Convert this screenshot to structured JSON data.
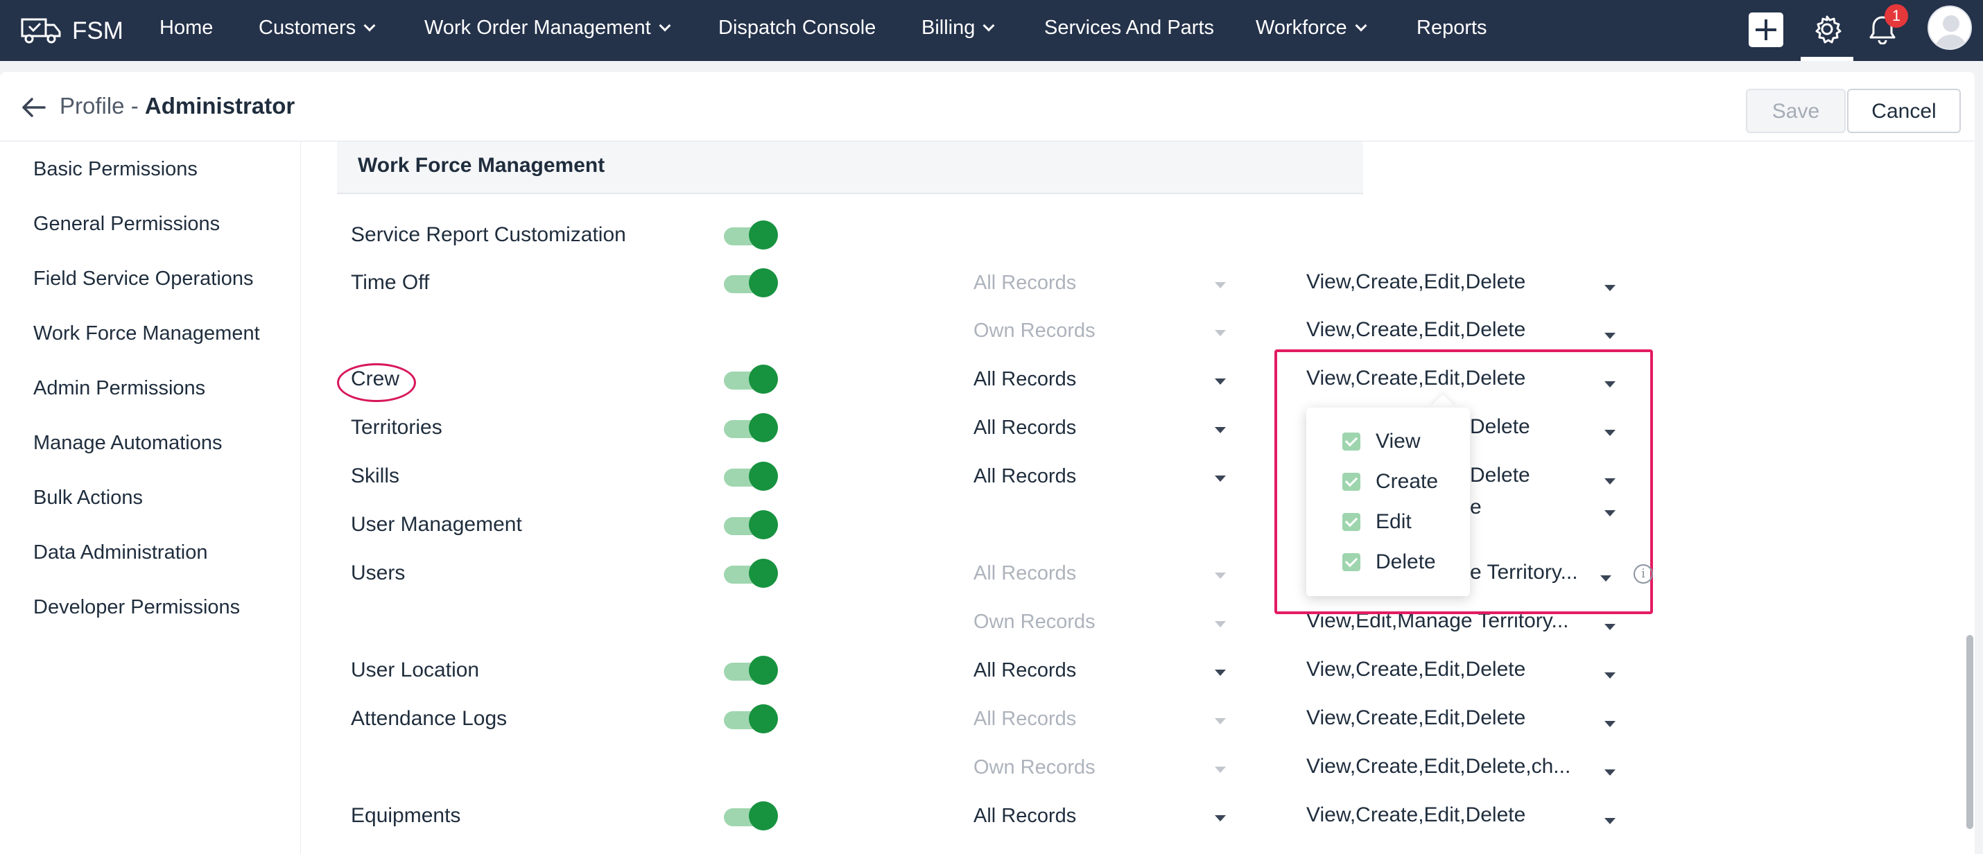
{
  "nav": {
    "brand": "FSM",
    "items": [
      {
        "label": "Home",
        "has_dropdown": false
      },
      {
        "label": "Customers",
        "has_dropdown": true
      },
      {
        "label": "Work Order Management",
        "has_dropdown": true
      },
      {
        "label": "Dispatch Console",
        "has_dropdown": false
      },
      {
        "label": "Billing",
        "has_dropdown": true
      },
      {
        "label": "Services And Parts",
        "has_dropdown": false
      },
      {
        "label": "Workforce",
        "has_dropdown": true
      },
      {
        "label": "Reports",
        "has_dropdown": false
      }
    ],
    "notification_count": "1",
    "icons": [
      "truck-icon",
      "plus-icon",
      "gear-icon",
      "bell-icon",
      "avatar"
    ]
  },
  "header": {
    "title_prefix": "Profile - ",
    "title_name": "Administrator",
    "save_label": "Save",
    "cancel_label": "Cancel"
  },
  "sidebar": {
    "items": [
      "Basic Permissions",
      "General Permissions",
      "Field Service Operations",
      "Work Force Management",
      "Admin Permissions",
      "Manage Automations",
      "Bulk Actions",
      "Data Administration",
      "Developer Permissions"
    ]
  },
  "section": {
    "title": "Work Force Management",
    "rows": [
      {
        "label": "Service Report Customization",
        "toggle": true,
        "scope": "",
        "scope_disabled": false,
        "perms": ""
      },
      {
        "label": "Time Off",
        "toggle": true,
        "scope": "All Records",
        "scope_disabled": true,
        "perms": "View,Create,Edit,Delete"
      },
      {
        "label": "",
        "toggle": false,
        "scope": "Own Records",
        "scope_disabled": true,
        "perms": "View,Create,Edit,Delete"
      },
      {
        "label": "Crew",
        "toggle": true,
        "scope": "All Records",
        "scope_disabled": false,
        "perms": "View,Create,Edit,Delete"
      },
      {
        "label": "Territories",
        "toggle": true,
        "scope": "All Records",
        "scope_disabled": false,
        "perms": "Delete"
      },
      {
        "label": "Skills",
        "toggle": true,
        "scope": "All Records",
        "scope_disabled": false,
        "perms": "Delete"
      },
      {
        "label": "User Management",
        "toggle": true,
        "scope": "",
        "scope_disabled": false,
        "perms": "e"
      },
      {
        "label": "Users",
        "toggle": true,
        "scope": "All Records",
        "scope_disabled": true,
        "perms": "e Territory..."
      },
      {
        "label": "",
        "toggle": false,
        "scope": "Own Records",
        "scope_disabled": true,
        "perms": "View,Edit,Manage Territory..."
      },
      {
        "label": "User Location",
        "toggle": true,
        "scope": "All Records",
        "scope_disabled": false,
        "perms": "View,Create,Edit,Delete"
      },
      {
        "label": "Attendance Logs",
        "toggle": true,
        "scope": "All Records",
        "scope_disabled": true,
        "perms": "View,Create,Edit,Delete"
      },
      {
        "label": "",
        "toggle": false,
        "scope": "Own Records",
        "scope_disabled": true,
        "perms": "View,Create,Edit,Delete,ch..."
      },
      {
        "label": "Equipments",
        "toggle": true,
        "scope": "All Records",
        "scope_disabled": false,
        "perms": "View,Create,Edit,Delete"
      }
    ]
  },
  "popup": {
    "options": [
      {
        "label": "View",
        "checked": true
      },
      {
        "label": "Create",
        "checked": true
      },
      {
        "label": "Edit",
        "checked": true
      },
      {
        "label": "Delete",
        "checked": true
      }
    ]
  },
  "colors": {
    "nav_bg": "#24324a",
    "toggle_on": "#17923f",
    "highlight": "#e31c62",
    "badge": "#e5383b"
  }
}
